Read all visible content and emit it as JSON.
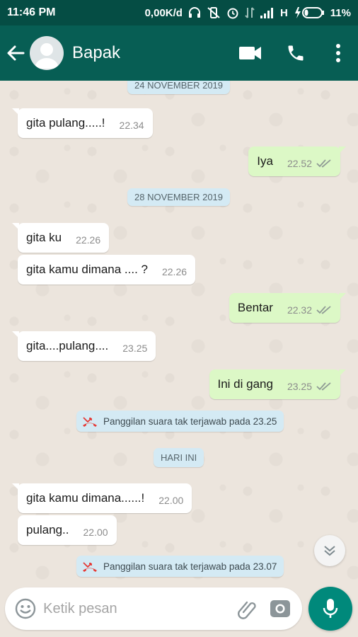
{
  "status_bar": {
    "time": "11:46 PM",
    "speed": "0,00K/d",
    "network": "H",
    "battery": "11%"
  },
  "header": {
    "contact_name": "Bapak"
  },
  "chat": {
    "date_1": "24 NOVEMBER 2019",
    "date_2": "28 NOVEMBER 2019",
    "date_3": "HARI INI",
    "messages": [
      {
        "text": "gita pulang.....!",
        "time": "22.34",
        "direction": "in"
      },
      {
        "text": "Iya",
        "time": "22.52",
        "direction": "out"
      },
      {
        "text": "gita ku",
        "time": "22.26",
        "direction": "in"
      },
      {
        "text": "gita kamu  dimana .... ?",
        "time": "22.26",
        "direction": "in"
      },
      {
        "text": "Bentar",
        "time": "22.32",
        "direction": "out"
      },
      {
        "text": "gita....pulang....",
        "time": "23.25",
        "direction": "in"
      },
      {
        "text": "Ini di gang",
        "time": "23.25",
        "direction": "out"
      },
      {
        "text": "gita kamu dimana......!",
        "time": "22.00",
        "direction": "in"
      },
      {
        "text": "pulang..",
        "time": "22.00",
        "direction": "in"
      }
    ],
    "missed_call_1": "Panggilan suara tak terjawab pada 23.25",
    "missed_call_2": "Panggilan suara tak terjawab pada 23.07"
  },
  "composer": {
    "placeholder": "Ketik pesan"
  },
  "colors": {
    "header": "#075e54",
    "status_bar": "#054d44",
    "outgoing_bubble": "#dcf8c6",
    "incoming_bubble": "#ffffff",
    "chip": "#d4eaf4",
    "mic_button": "#00897b",
    "missed_call": "#e53935",
    "read_ticks": "#8e9a94"
  },
  "icons": [
    "back-arrow-icon",
    "video-call-icon",
    "phone-icon",
    "more-vert-icon",
    "missed-call-icon",
    "double-check-icon",
    "chevron-down-icon",
    "emoji-icon",
    "attach-icon",
    "camera-icon",
    "mic-icon"
  ]
}
